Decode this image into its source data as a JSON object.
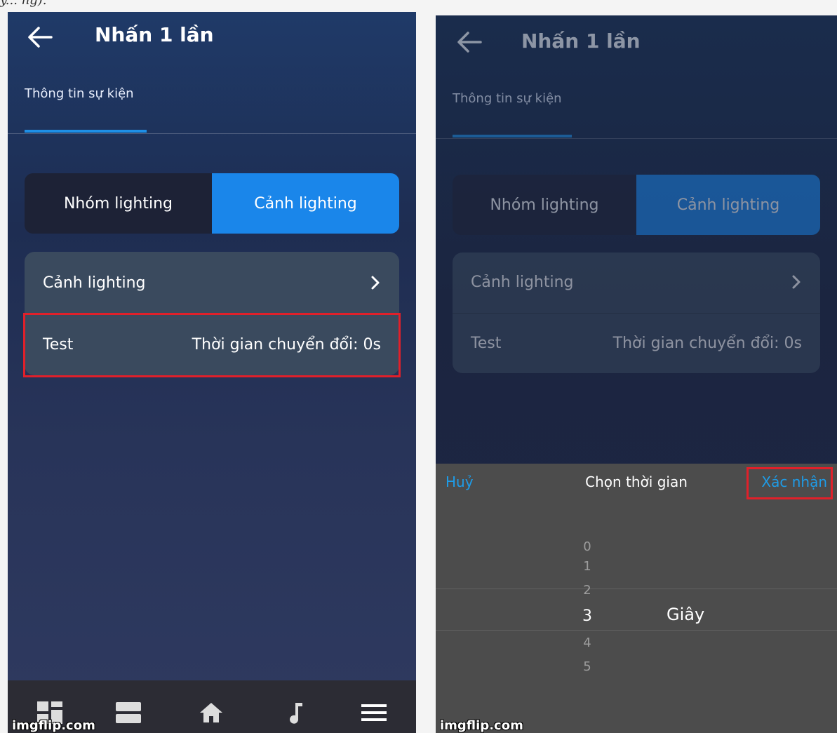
{
  "caption_fragment": "y... ng).",
  "left_screen": {
    "title": "Nhấn 1 lần",
    "tab": "Thông tin sự kiện",
    "segment": {
      "off_label": "Nhóm lighting",
      "on_label": "Cảnh lighting"
    },
    "rows": [
      {
        "label": "Cảnh lighting",
        "value": ""
      },
      {
        "label": "Test",
        "value": "Thời gian chuyển đổi: 0s"
      }
    ],
    "bottom_nav": [
      "dashboard-icon",
      "list-icon",
      "home-icon",
      "music-icon",
      "menu-icon"
    ],
    "watermark": "imgflip.com"
  },
  "right_screen": {
    "title": "Nhấn 1 lần",
    "tab": "Thông tin sự kiện",
    "segment": {
      "off_label": "Nhóm lighting",
      "on_label": "Cảnh lighting"
    },
    "rows": [
      {
        "label": "Cảnh lighting",
        "value": ""
      },
      {
        "label": "Test",
        "value": "Thời gian chuyển đổi: 0s"
      }
    ],
    "picker": {
      "cancel": "Huỷ",
      "title": "Chọn thời gian",
      "confirm": "Xác nhận",
      "numbers": [
        "0",
        "1",
        "2",
        "3",
        "4",
        "5"
      ],
      "selected_index": 3,
      "unit": "Giây"
    },
    "watermark": "imgflip.com"
  },
  "colors": {
    "accent": "#1a86ea",
    "link": "#1e9ce8",
    "highlight": "#e0202a"
  }
}
